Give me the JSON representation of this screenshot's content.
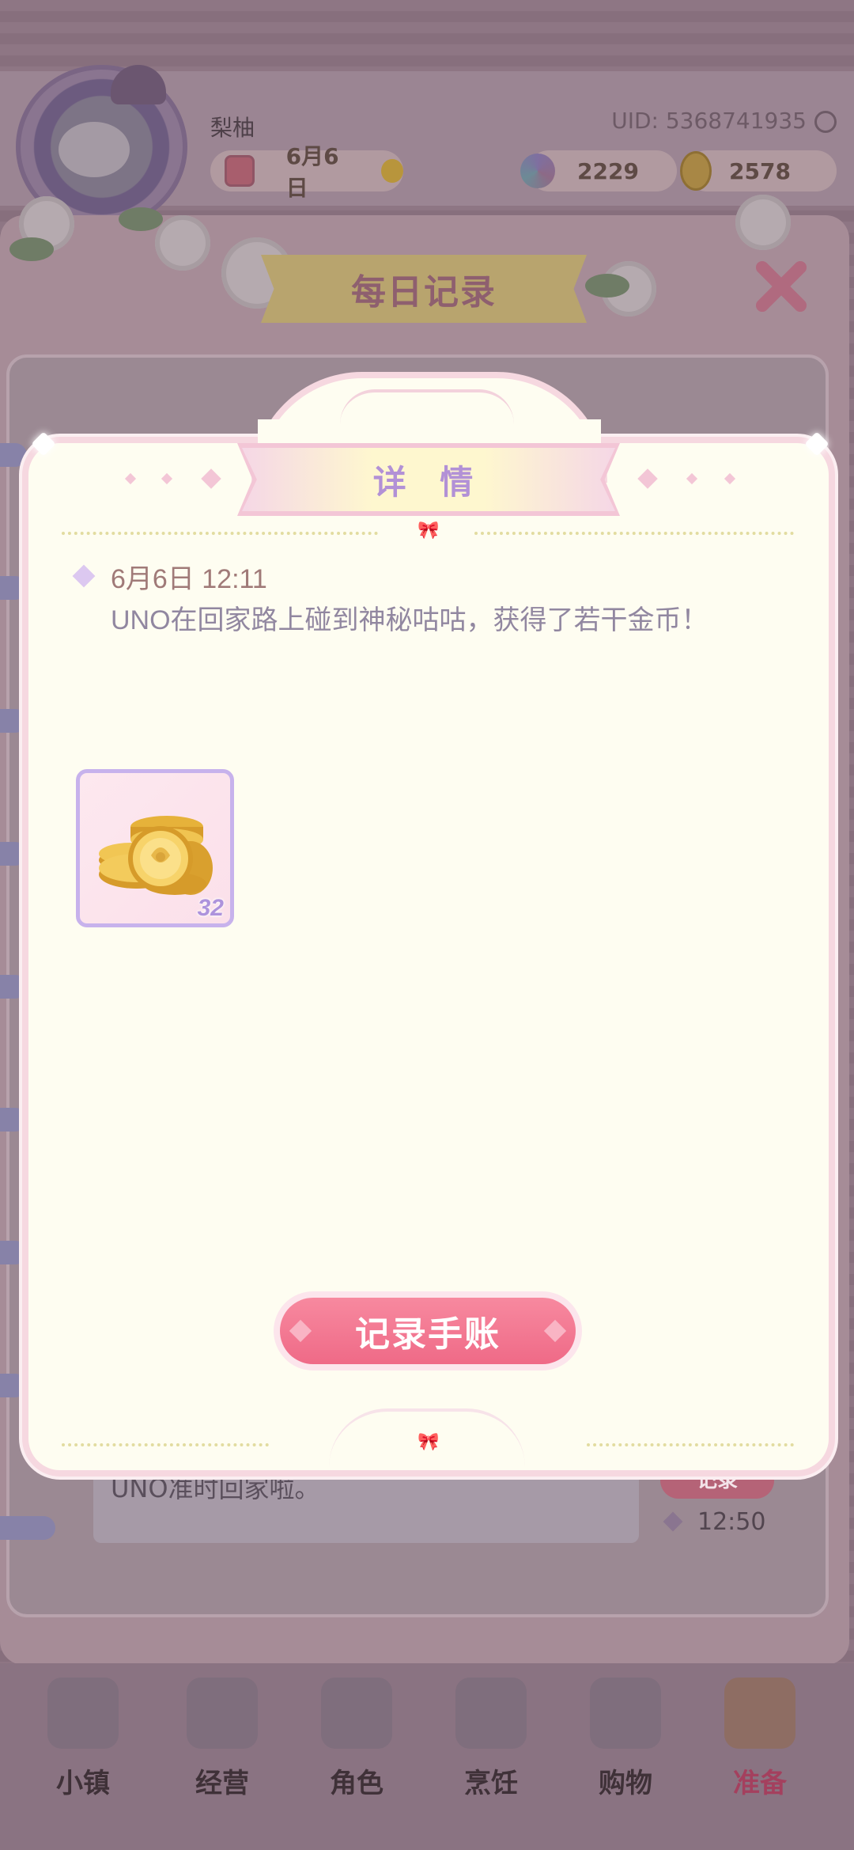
{
  "user": {
    "name": "梨柚",
    "uid": "UID: 5368741935"
  },
  "status": {
    "date": "6月6日",
    "gems": "2229",
    "coins": "2578"
  },
  "record_panel": {
    "title": "每日记录",
    "entry_text": "UNO准时回家啦。",
    "entry_button": "记录",
    "entry_time": "12:50"
  },
  "detail": {
    "title": "详 情",
    "time": "6月6日 12:11",
    "text": "UNO在回家路上碰到神秘咕咕，获得了若干金币！",
    "reward": {
      "icon": "gold-coins-icon",
      "count": "32"
    },
    "button": "记录手账"
  },
  "nav": [
    {
      "label": "小镇",
      "icon": "map-icon"
    },
    {
      "label": "经营",
      "icon": "bag-icon"
    },
    {
      "label": "角色",
      "icon": "character-icon"
    },
    {
      "label": "烹饪",
      "icon": "burger-icon"
    },
    {
      "label": "购物",
      "icon": "shopping-bag-icon"
    },
    {
      "label": "准备",
      "icon": "picnic-basket-icon",
      "active": true
    }
  ],
  "colors": {
    "accent": "#ef6a87",
    "title_purple": "#b291d6",
    "modal_bg": "#fefdf1"
  }
}
